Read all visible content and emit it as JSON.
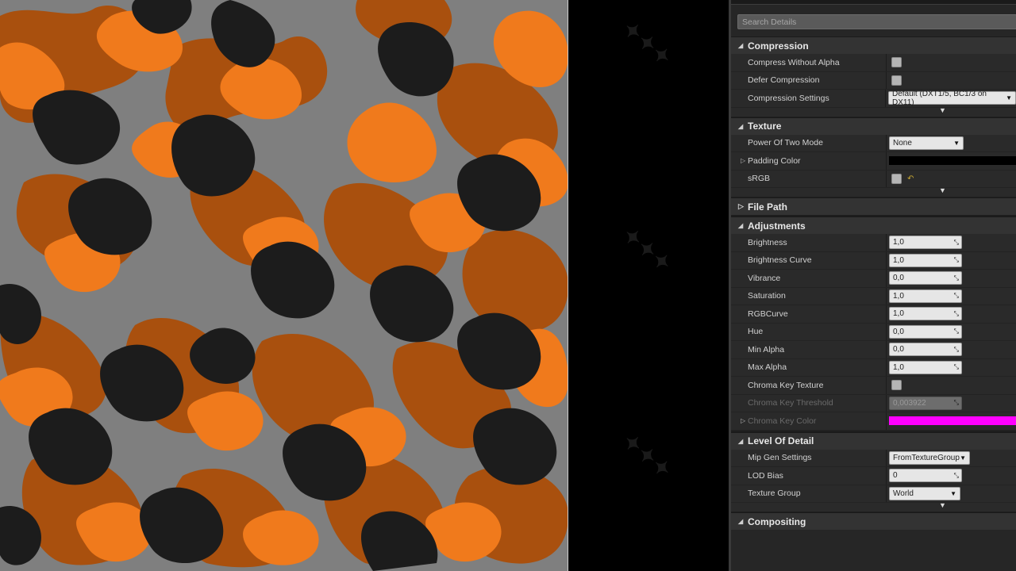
{
  "search": {
    "placeholder": "Search Details"
  },
  "colors": {
    "camo_gray": "#7f7f7f",
    "camo_black": "#1c1c1c",
    "camo_orange": "#f07a1c",
    "camo_brown": "#a9500e",
    "padding_color": "#000000",
    "chroma_key_color": "#ff00ff"
  },
  "compression": {
    "title": "Compression",
    "compress_without_alpha": "Compress Without Alpha",
    "defer_compression": "Defer Compression",
    "compression_settings": "Compression Settings",
    "compression_settings_value": "Default (DXT1/5, BC1/3 on DX11)"
  },
  "texture": {
    "title": "Texture",
    "power_of_two_mode": "Power Of Two Mode",
    "power_of_two_value": "None",
    "padding_color": "Padding Color",
    "srgb": "sRGB"
  },
  "file_path": {
    "title": "File Path"
  },
  "adjustments": {
    "title": "Adjustments",
    "rows": [
      {
        "label": "Brightness",
        "value": "1,0"
      },
      {
        "label": "Brightness Curve",
        "value": "1,0"
      },
      {
        "label": "Vibrance",
        "value": "0,0"
      },
      {
        "label": "Saturation",
        "value": "1,0"
      },
      {
        "label": "RGBCurve",
        "value": "1,0"
      },
      {
        "label": "Hue",
        "value": "0,0"
      },
      {
        "label": "Min Alpha",
        "value": "0,0"
      },
      {
        "label": "Max Alpha",
        "value": "1,0"
      }
    ],
    "chroma_key_texture": "Chroma Key Texture",
    "chroma_key_threshold": "Chroma Key Threshold",
    "chroma_key_threshold_value": "0,003922",
    "chroma_key_color": "Chroma Key Color"
  },
  "lod": {
    "title": "Level Of Detail",
    "mip_gen_settings": "Mip Gen Settings",
    "mip_gen_value": "FromTextureGroup",
    "lod_bias": "LOD Bias",
    "lod_bias_value": "0",
    "texture_group": "Texture Group",
    "texture_group_value": "World"
  },
  "compositing": {
    "title": "Compositing"
  }
}
